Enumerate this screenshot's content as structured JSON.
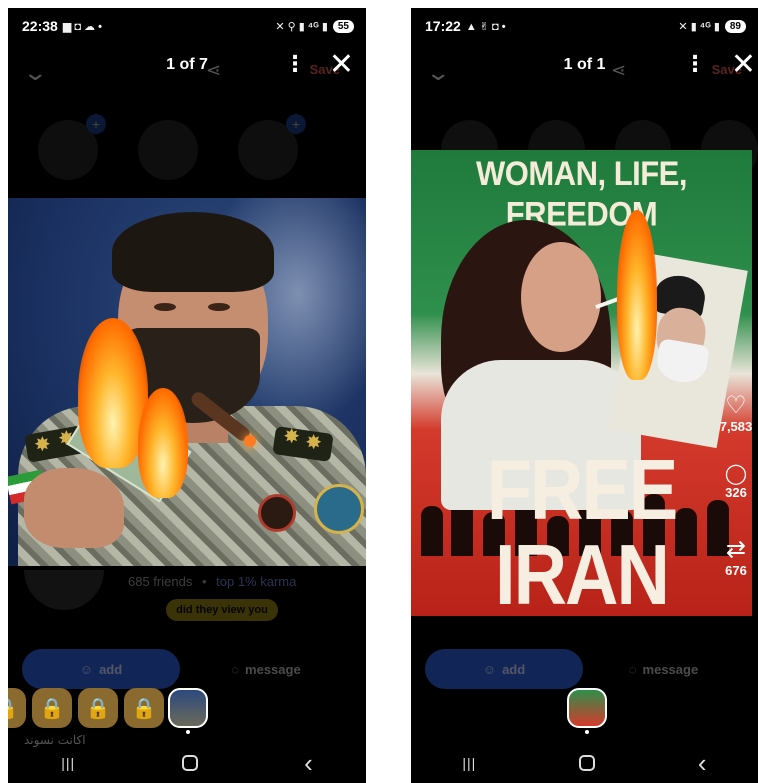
{
  "left": {
    "status": {
      "time": "22:38",
      "icons_left": "▆ ◘ ☁ •",
      "icons_right": "✕ ⚲ ▮ ⁴ᴳ ▮",
      "battery": "55"
    },
    "header": {
      "counter": "1 of 7",
      "save_label": "Save"
    },
    "profile": {
      "friends": "685 friends",
      "dot": "•",
      "karma": "top 1% karma",
      "pill": "did they view you"
    },
    "buttons": {
      "add": "add",
      "message": "message"
    },
    "rtl_text": "اکانت نسوند"
  },
  "right": {
    "status": {
      "time": "17:22",
      "icons_left": "▲ ✌ ◘ •",
      "icons_right": "✕ ▮ ⁴ᴳ ▮",
      "battery": "89"
    },
    "header": {
      "counter": "1 of 1",
      "save_label": "Save"
    },
    "poster": {
      "title": "WOMAN, LIFE, FREEDOM",
      "bottom": "FREE IRAN"
    },
    "rail": {
      "likes": "7,583",
      "comments": "326",
      "reposts": "676"
    },
    "buttons": {
      "add": "add",
      "message": "message"
    }
  },
  "icons": {
    "close": "✕",
    "kebab": "⋮",
    "chevron": "⌄",
    "share": "⋖",
    "heart": "♡",
    "comment": "◯",
    "repost": "⇄",
    "lock": "🔒",
    "nav_recents": "|||",
    "nav_back": "‹",
    "person_plus": "☺",
    "message": "◌"
  },
  "colors": {
    "accent_blue": "#2b5fd6",
    "pill_yellow": "#b3a018"
  }
}
